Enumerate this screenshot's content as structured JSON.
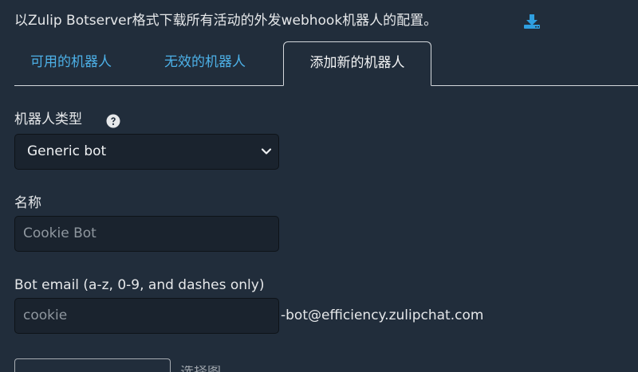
{
  "intro": {
    "text": "以Zulip Botserver格式下载所有活动的外发webhook机器人的配置。",
    "download_icon": "download-icon"
  },
  "tabs": [
    {
      "label": "可用的机器人",
      "active": false
    },
    {
      "label": "无效的机器人",
      "active": false
    },
    {
      "label": "添加新的机器人",
      "active": true
    }
  ],
  "form": {
    "bot_type": {
      "label": "机器人类型",
      "help_icon": "question-circle-icon",
      "selected": "Generic bot"
    },
    "name": {
      "label": "名称",
      "placeholder": "Cookie Bot"
    },
    "email": {
      "label": "Bot email (a-z, 0-9, and dashes only)",
      "placeholder": "cookie",
      "suffix": "-bot@efficiency.zulipchat.com"
    },
    "next_partial": {
      "text": "选择图"
    }
  },
  "colors": {
    "background": "#212d3b",
    "link": "#4db1e8",
    "text": "#e6e8ea",
    "field_bg": "#1a232e"
  }
}
